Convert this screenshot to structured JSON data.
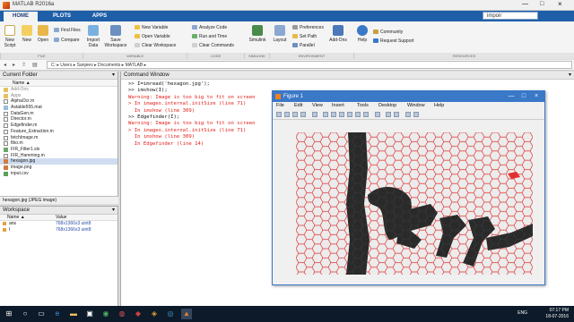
{
  "app": {
    "title": "MATLAB R2016a"
  },
  "tabs": [
    {
      "label": "HOME"
    },
    {
      "label": "PLOTS"
    },
    {
      "label": "APPS"
    }
  ],
  "search": {
    "value": "impoir"
  },
  "ribbon": {
    "new_script": "New\nScript",
    "new": "New",
    "open": "Open",
    "find_files": "Find Files",
    "compare": "Compare",
    "import_data": "Import\nData",
    "save_workspace": "Save\nWorkspace",
    "new_variable": "New Variable",
    "open_variable": "Open Variable",
    "clear_workspace": "Clear Workspace",
    "analyze_code": "Analyze Code",
    "run_and_time": "Run and Time",
    "clear_commands": "Clear Commands",
    "simulink": "Simulink",
    "layout": "Layout",
    "preferences": "Preferences",
    "set_path": "Set Path",
    "parallel": "Parallel",
    "add_ons": "Add-Ons",
    "help": "Help",
    "community": "Community",
    "request_support": "Request Support",
    "groups": {
      "file": "FILE",
      "variable": "VARIABLE",
      "code": "CODE",
      "simulink": "SIMULINK",
      "environment": "ENVIRONMENT",
      "resources": "RESOURCES"
    }
  },
  "address": {
    "path": "C: ▸ Users ▸ Sanjeev ▸ Documents ▸ MATLAB ▸"
  },
  "current_folder": {
    "title": "Current Folder",
    "col_name": "Name ▲",
    "files": [
      "Add-Ons",
      "Apps",
      "AlphaOcr.m",
      "Astable555.mat",
      "DataGen.m",
      "Director.m",
      "Edgefinder.m",
      "Feature_Extraction.m",
      "fetchImage.m",
      "fibo.m",
      "FIR_Filter1.slx",
      "FIR_Hamming.m",
      "hexagon.jpg",
      "image.png",
      "input.csv"
    ],
    "details": "hexagon.jpg (JPEG image)"
  },
  "workspace": {
    "title": "Workspace",
    "col_name": "Name ▲",
    "col_value": "Value",
    "rows": [
      {
        "name": "ans",
        "value": "768x1366x3 uint8"
      },
      {
        "name": "I",
        "value": "768x1366x3 uint8"
      }
    ]
  },
  "command_window": {
    "title": "Command Window",
    "lines": [
      {
        "t": ">> I=imread('hexagon.jpg');",
        "c": "normal"
      },
      {
        "t": ">> imshow(I);",
        "c": "normal"
      },
      {
        "t": "Warning: Image is too big to fit on screen",
        "c": "red"
      },
      {
        "t": "> In images.internal.initSize (line 71)",
        "c": "red"
      },
      {
        "t": "  In imshow (line 309)",
        "c": "red"
      },
      {
        "t": ">> Edgefinder(I);",
        "c": "normal"
      },
      {
        "t": "Warning: Image is too big to fit on screen",
        "c": "red"
      },
      {
        "t": "> In images.internal.initSize (line 71)",
        "c": "red"
      },
      {
        "t": "  In imshow (line 309)",
        "c": "red"
      },
      {
        "t": "  In Edgefinder (line 14)",
        "c": "red"
      }
    ]
  },
  "figure": {
    "title": "Figure 1",
    "menu": [
      "File",
      "Edit",
      "View",
      "Insert",
      "Tools",
      "Desktop",
      "Window",
      "Help"
    ]
  },
  "taskbar": {
    "lang": "ENG",
    "time": "07:17 PM",
    "date": "18-07-2016"
  },
  "colors": {
    "accent": "#1e5fa8",
    "figure_title": "#3a78c8",
    "warning": "#e0201a"
  }
}
